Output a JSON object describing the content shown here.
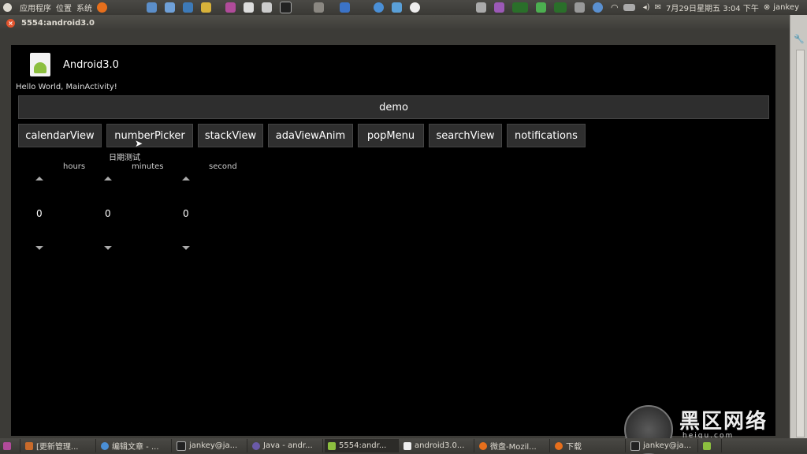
{
  "top_panel": {
    "menu": [
      "应用程序",
      "位置",
      "系统"
    ],
    "clock": "7月29日星期五 3:04 下午",
    "user": "jankey"
  },
  "window": {
    "title": "5554:android3.0",
    "close_label": "×"
  },
  "app": {
    "title": "Android3.0",
    "hello": "Hello World, MainActivity!",
    "demo_button": "demo",
    "buttons": [
      "calendarView",
      "numberPicker",
      "stackView",
      "adaViewAnim",
      "popMenu",
      "searchView",
      "notifications"
    ],
    "tooltip": "日期测试",
    "pickers": {
      "labels": [
        "hours",
        "minutes",
        "second"
      ],
      "values": [
        "0",
        "0",
        "0"
      ]
    }
  },
  "taskbar": {
    "tasks": [
      "[更新管理...",
      "编辑文章 - ...",
      "jankey@ja...",
      "Java - andr...",
      "5554:andr...",
      "android3.0...",
      "微盘-Mozil...",
      "下载",
      "jankey@ja..."
    ]
  },
  "watermark": {
    "text": "黑区网络",
    "sub": "heiqu.com"
  },
  "colors": {
    "panel_bg": "#3c3b37",
    "screen_bg": "#000000",
    "button_bg": "#2f2f2f",
    "close_button": "#e0532d"
  }
}
